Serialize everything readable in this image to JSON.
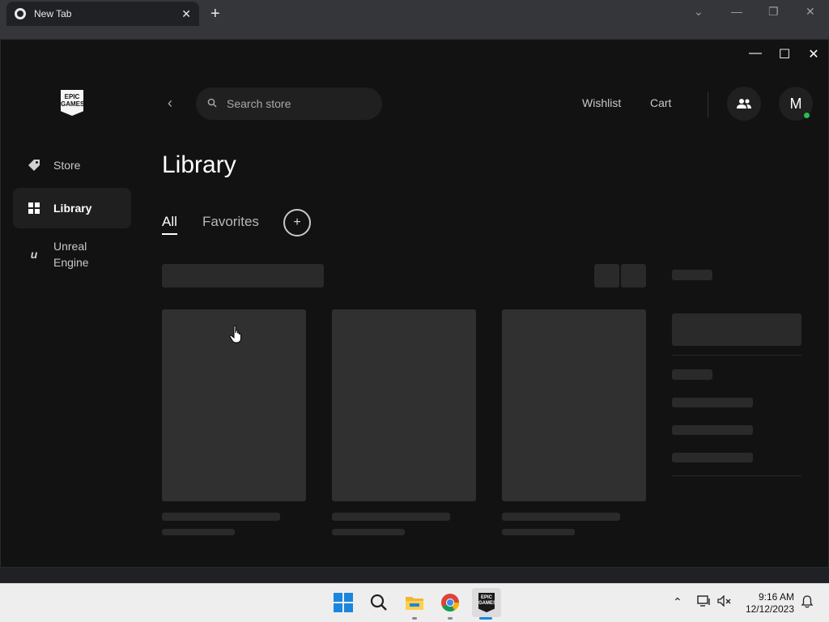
{
  "browser": {
    "tab_title": "New Tab",
    "tab_close": "✕",
    "new_tab": "+"
  },
  "epic": {
    "logo_text": "EPIC GAMES",
    "window_controls": [
      "—",
      "☐",
      "✕"
    ],
    "sidebar": [
      {
        "label": "Store",
        "icon": "tag-icon"
      },
      {
        "label": "Library",
        "icon": "grid-icon"
      },
      {
        "label": "Unreal Engine",
        "icon": "unreal-icon"
      }
    ],
    "search": {
      "placeholder": "Search store"
    },
    "header": {
      "wishlist": "Wishlist",
      "cart": "Cart",
      "avatar_initial": "M"
    },
    "page_title": "Library",
    "tabs": {
      "all": "All",
      "favorites": "Favorites",
      "add": "+"
    }
  },
  "taskbar": {
    "time": "9:16 AM",
    "date": "12/12/2023"
  },
  "colors": {
    "background": "#121212",
    "online": "#2bbd4e",
    "skeleton": "#2a2a2a",
    "card": "#303030"
  }
}
